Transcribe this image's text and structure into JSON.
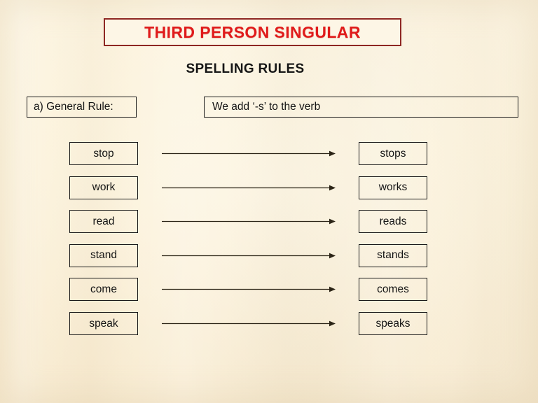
{
  "slide": {
    "background_color": "#fbf0d9",
    "title": {
      "text": "THIRD PERSON SINGULAR",
      "text_color": "#e01b1b",
      "border_color": "#8e2723"
    },
    "subtitle": "SPELLING RULES"
  },
  "rule": {
    "label": "a) General Rule:",
    "description": "We add ‘-s’ to the verb"
  },
  "verb_rows": [
    {
      "base": "stop",
      "third_person": "stops",
      "arrow": "right-arrow-icon"
    },
    {
      "base": "work",
      "third_person": "works",
      "arrow": "right-arrow-icon"
    },
    {
      "base": "read",
      "third_person": "reads",
      "arrow": "right-arrow-icon"
    },
    {
      "base": "stand",
      "third_person": "stands",
      "arrow": "right-arrow-icon"
    },
    {
      "base": "come",
      "third_person": "comes",
      "arrow": "right-arrow-icon"
    },
    {
      "base": "speak",
      "third_person": "speaks",
      "arrow": "right-arrow-icon"
    }
  ]
}
